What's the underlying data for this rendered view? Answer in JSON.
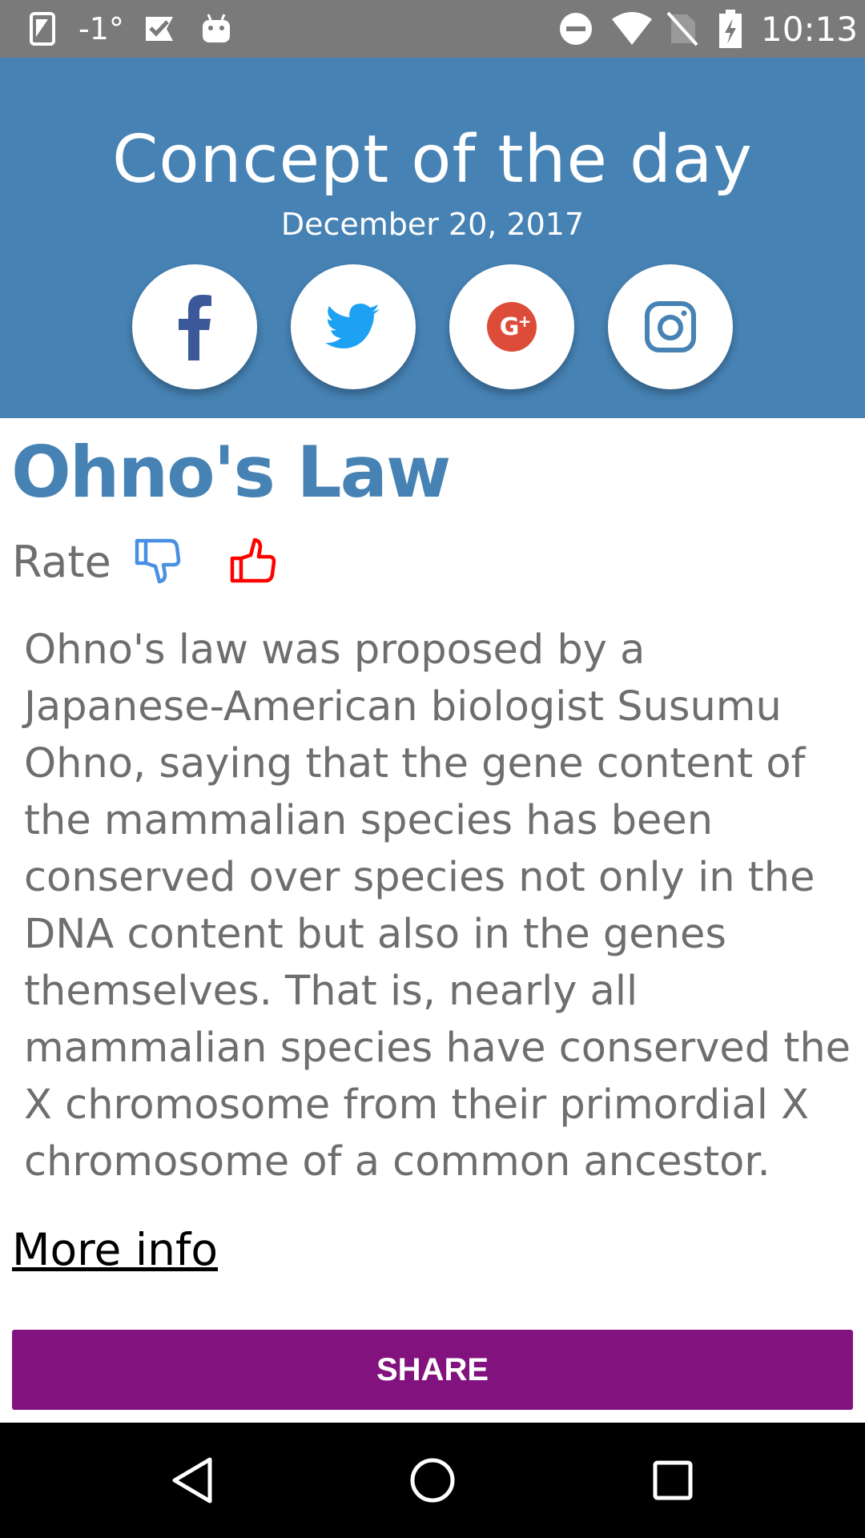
{
  "status_bar": {
    "temperature": "-1°",
    "time": "10:13",
    "icons": [
      "phone-icon",
      "check-badge-icon",
      "android-icon",
      "do-not-disturb-icon",
      "wifi-icon",
      "no-sim-icon",
      "battery-charging-icon"
    ]
  },
  "header": {
    "title": "Concept of the day",
    "date": "December 20, 2017",
    "social": [
      {
        "name": "facebook-icon",
        "color": "#3b5998"
      },
      {
        "name": "twitter-icon",
        "color": "#1da1f2"
      },
      {
        "name": "google-plus-icon",
        "color": "#dd4b39"
      },
      {
        "name": "instagram-icon",
        "color": "#4682b4"
      }
    ]
  },
  "concept": {
    "title": "Ohno's Law",
    "rate_label": "Rate",
    "thumbs_down_color": "#4a90e2",
    "thumbs_up_color": "#ff0000",
    "description": "Ohno's law was proposed by a Japanese-American biologist Susumu Ohno, saying that the gene content of the mammalian species has been conserved over species not only in the DNA content but also in the genes themselves. That is, nearly all mammalian species have conserved the X chromosome from their primordial X chromosome of a common ancestor.",
    "more_info_label": "More info"
  },
  "actions": {
    "share_label": "SHARE"
  },
  "colors": {
    "header_bg": "#4682b4",
    "share_bg": "#82137e",
    "status_bar_bg": "#7a7a7a",
    "text_gray": "#6e6e6e"
  },
  "nav_bar": {
    "icons": [
      "back-icon",
      "home-icon",
      "recents-icon"
    ]
  }
}
